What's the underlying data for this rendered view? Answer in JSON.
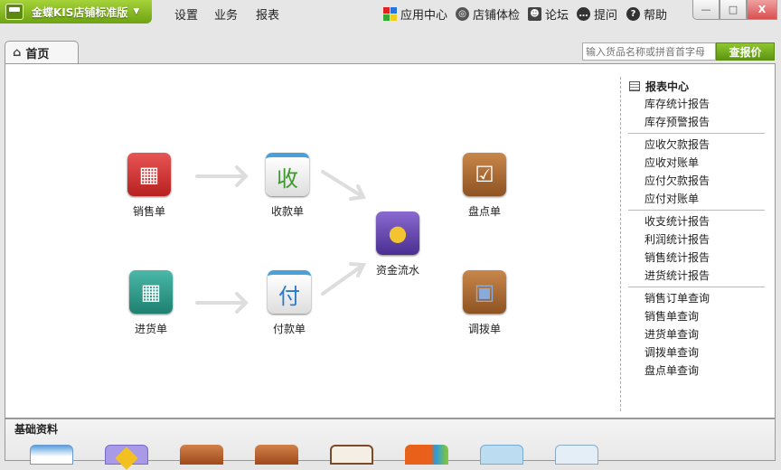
{
  "app": {
    "title": "金蝶KIS店铺标准版"
  },
  "menu": [
    "设置",
    "业务",
    "报表"
  ],
  "tools": [
    {
      "label": "应用中心",
      "icon": "app-center-icon"
    },
    {
      "label": "店铺体检",
      "icon": "checkup-icon"
    },
    {
      "label": "论坛",
      "icon": "forum-icon"
    },
    {
      "label": "提问",
      "icon": "question-bubble-icon"
    },
    {
      "label": "帮助",
      "icon": "help-icon"
    }
  ],
  "window": {
    "minimize": "—",
    "maximize": "□",
    "close": "X"
  },
  "tab": {
    "label": "首页"
  },
  "search": {
    "placeholder": "输入货品名称或拼音首字母",
    "button": "查报价"
  },
  "flow": {
    "sales": "销售单",
    "receipt": "收款单",
    "stocktake": "盘点单",
    "cashflow": "资金流水",
    "purchase": "进货单",
    "payment": "付款单",
    "transfer": "调拨单",
    "receipt_glyph": "收",
    "payment_glyph": "付"
  },
  "reports": {
    "title": "报表中心",
    "groups": [
      [
        "库存统计报告",
        "库存预警报告"
      ],
      [
        "应收欠款报告",
        "应收对账单",
        "应付欠款报告",
        "应付对账单"
      ],
      [
        "收支统计报告",
        "利润统计报告",
        "销售统计报告",
        "进货统计报告"
      ],
      [
        "销售订单查询",
        "销售单查询",
        "进货单查询",
        "调拨单查询",
        "盘点单查询"
      ]
    ]
  },
  "basic": {
    "title": "基础资料"
  },
  "colors": {
    "accent": "#7ab51d"
  }
}
